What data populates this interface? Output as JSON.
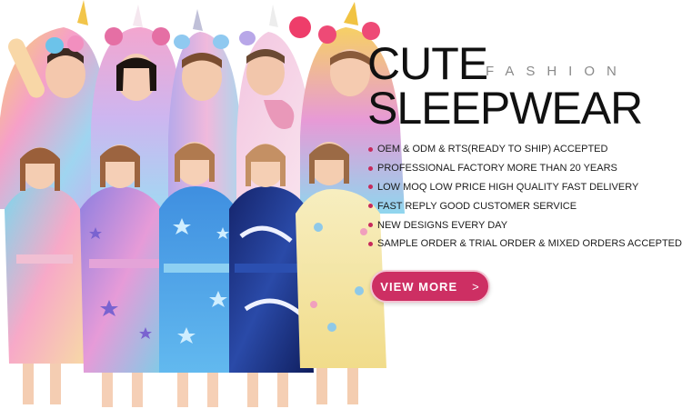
{
  "banner": {
    "title_line1": "CUTE",
    "title_line2": "SLEEPWEAR",
    "tagline": "FASHION",
    "features": [
      "OEM & ODM & RTS(READY TO SHIP) ACCEPTED",
      "PROFESSIONAL FACTORY MORE THAN 20 YEARS",
      "LOW MOQ LOW PRICE HIGH QUALITY FAST DELIVERY",
      "FAST REPLY GOOD CUSTOMER SERVICE",
      "NEW DESIGNS EVERY DAY",
      "SAMPLE ORDER & TRIAL ORDER & MIXED ORDERS ACCEPTED"
    ],
    "cta_label": "VIEW MORE",
    "cta_arrow": ">"
  },
  "colors": {
    "accent": "#cd2f63",
    "bullet": "#c72a5b",
    "title": "#111111",
    "tagline": "#8a8a8a"
  },
  "icons": {
    "bullet": "dot-icon",
    "cta_arrow": "chevron-right-icon"
  }
}
